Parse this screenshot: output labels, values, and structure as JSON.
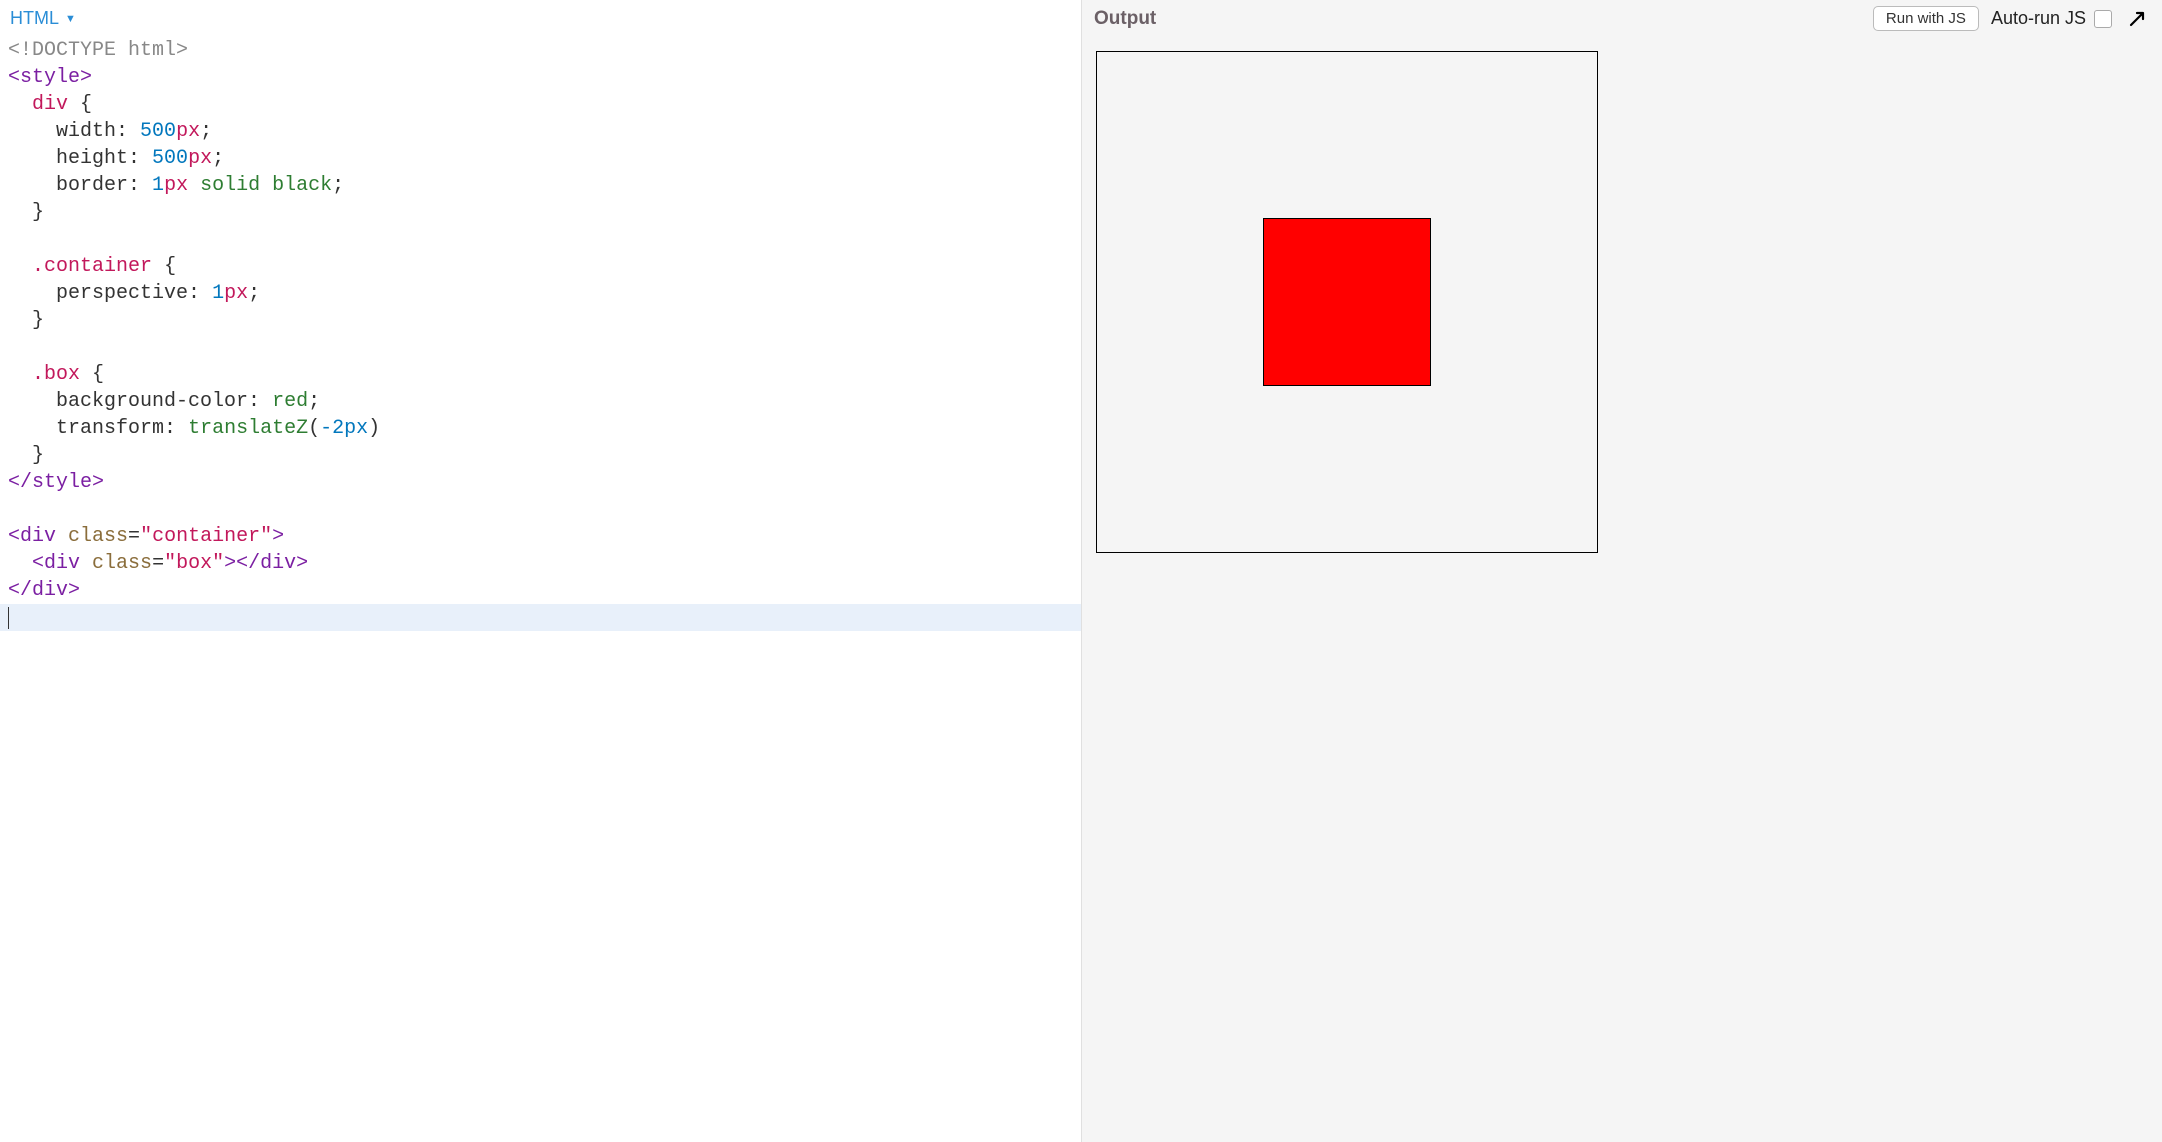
{
  "editor": {
    "language_label": "HTML",
    "code_lines": [
      {
        "type": "doctype",
        "tokens": [
          "<!DOCTYPE html>"
        ]
      },
      {
        "type": "tag",
        "tokens": [
          "<style>"
        ]
      },
      {
        "type": "css_selector",
        "indent": 2,
        "tokens": [
          "div {"
        ]
      },
      {
        "type": "css_decl",
        "indent": 4,
        "prop": "width",
        "value": "500",
        "unit": "px"
      },
      {
        "type": "css_decl",
        "indent": 4,
        "prop": "height",
        "value": "500",
        "unit": "px"
      },
      {
        "type": "css_decl_triple",
        "indent": 4,
        "prop": "border",
        "value": "1px solid black"
      },
      {
        "type": "css_close",
        "indent": 2,
        "tokens": [
          "}"
        ]
      },
      {
        "type": "blank"
      },
      {
        "type": "css_selector",
        "indent": 2,
        "tokens": [
          ".container {"
        ]
      },
      {
        "type": "css_decl",
        "indent": 4,
        "prop": "perspective",
        "value": "1",
        "unit": "px"
      },
      {
        "type": "css_close",
        "indent": 2,
        "tokens": [
          "}"
        ]
      },
      {
        "type": "blank"
      },
      {
        "type": "css_selector",
        "indent": 2,
        "tokens": [
          ".box {"
        ]
      },
      {
        "type": "css_decl_keyword",
        "indent": 4,
        "prop": "background-color",
        "value": "red"
      },
      {
        "type": "css_decl_func",
        "indent": 4,
        "prop": "transform",
        "func": "translateZ",
        "arg": "-2px"
      },
      {
        "type": "css_close",
        "indent": 2,
        "tokens": [
          "}"
        ]
      },
      {
        "type": "tag",
        "tokens": [
          "</style>"
        ]
      },
      {
        "type": "blank"
      },
      {
        "type": "html_open_attr",
        "tag": "div",
        "attr": "class",
        "value": "container"
      },
      {
        "type": "html_open_close_attr",
        "indent": 2,
        "tag": "div",
        "attr": "class",
        "value": "box"
      },
      {
        "type": "html_close",
        "tag": "div"
      },
      {
        "type": "active_blank"
      }
    ]
  },
  "output": {
    "title": "Output",
    "run_button": "Run with JS",
    "autorun_label": "Auto-run JS",
    "autorun_checked": false
  },
  "preview": {
    "container_size_px": 500,
    "box_color": "red"
  }
}
